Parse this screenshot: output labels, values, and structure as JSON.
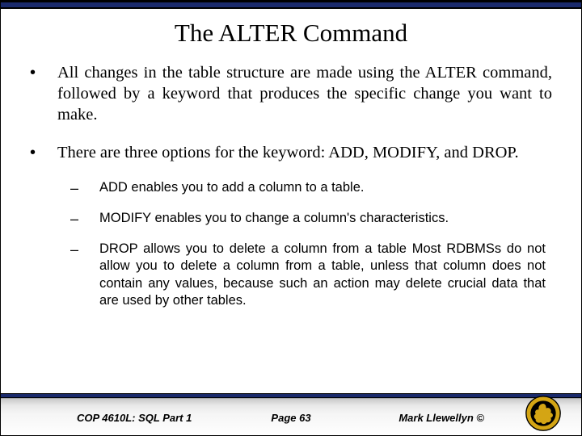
{
  "title": "The ALTER Command",
  "bullets": [
    "All changes in the table structure are made using the ALTER command, followed by a keyword that produces the specific change you want to make.",
    "There are three options for the keyword: ADD, MODIFY, and DROP."
  ],
  "sub_bullets": [
    "ADD enables you to add a column to a table.",
    "MODIFY enables you to change a column's characteristics.",
    "DROP allows you to delete a column from a table Most RDBMSs do not allow you to delete a column from a table, unless that column does not contain any values, because such an action may delete crucial data that are used by other tables."
  ],
  "footer": {
    "left": "COP 4610L: SQL Part 1",
    "center": "Page 63",
    "right": "Mark Llewellyn ©"
  },
  "logo_name": "ucf-pegasus-logo"
}
